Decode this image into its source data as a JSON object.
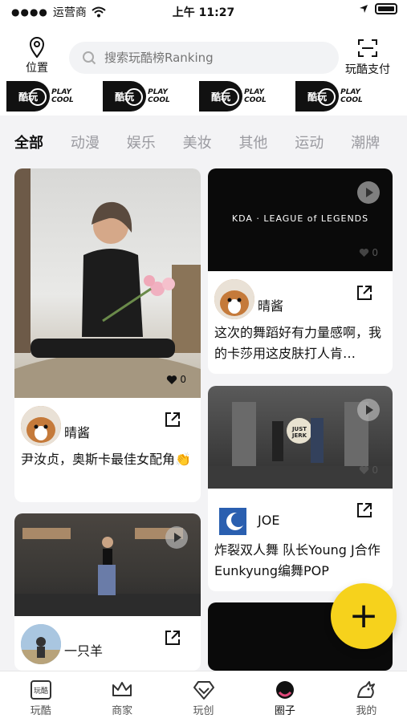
{
  "status": {
    "carrier": "运营商",
    "time": "上午 11:27"
  },
  "header": {
    "location_label": "位置",
    "search_placeholder": "搜索玩酷榜Ranking",
    "pay_label": "玩酷支付"
  },
  "banners": [
    {
      "logo_text": "酷玩",
      "brand_text": "PLAY COOL"
    },
    {
      "logo_text": "酷玩",
      "brand_text": "PLAY COOL"
    },
    {
      "logo_text": "酷玩",
      "brand_text": "PLAY COOL"
    },
    {
      "logo_text": "酷玩",
      "brand_text": "PLAY COOL"
    }
  ],
  "tabs": [
    {
      "label": "全部",
      "active": true
    },
    {
      "label": "动漫"
    },
    {
      "label": "娱乐"
    },
    {
      "label": "美妆"
    },
    {
      "label": "其他"
    },
    {
      "label": "运动"
    },
    {
      "label": "潮牌"
    }
  ],
  "posts": [
    {
      "author": "晴酱",
      "text": "尹汝贞，奥斯卡最佳女配角👏",
      "likes": "0"
    },
    {
      "author": "晴酱",
      "text": "这次的舞蹈好有力量感啊，我的卡莎用这皮肤打人肯…",
      "likes": "0",
      "video_caption": "KDA · LEAGUE of LEGENDS"
    },
    {
      "author": "JOE",
      "text": "炸裂双人舞 队长Young J合作Eunkyung编舞POP",
      "likes": "0",
      "video_caption": "JUST JERK"
    },
    {
      "author": "一只羊",
      "text": "",
      "likes": ""
    }
  ],
  "fab": {
    "label": "+"
  },
  "nav": [
    {
      "label": "玩酷",
      "icon": "wanku-icon"
    },
    {
      "label": "商家",
      "icon": "crown-icon"
    },
    {
      "label": "玩创",
      "icon": "diamond-icon"
    },
    {
      "label": "圈子",
      "icon": "circle-icon",
      "active": true
    },
    {
      "label": "我的",
      "icon": "dragon-icon"
    }
  ],
  "colors": {
    "accent": "#f6d21c",
    "background": "#f3f3f5"
  }
}
